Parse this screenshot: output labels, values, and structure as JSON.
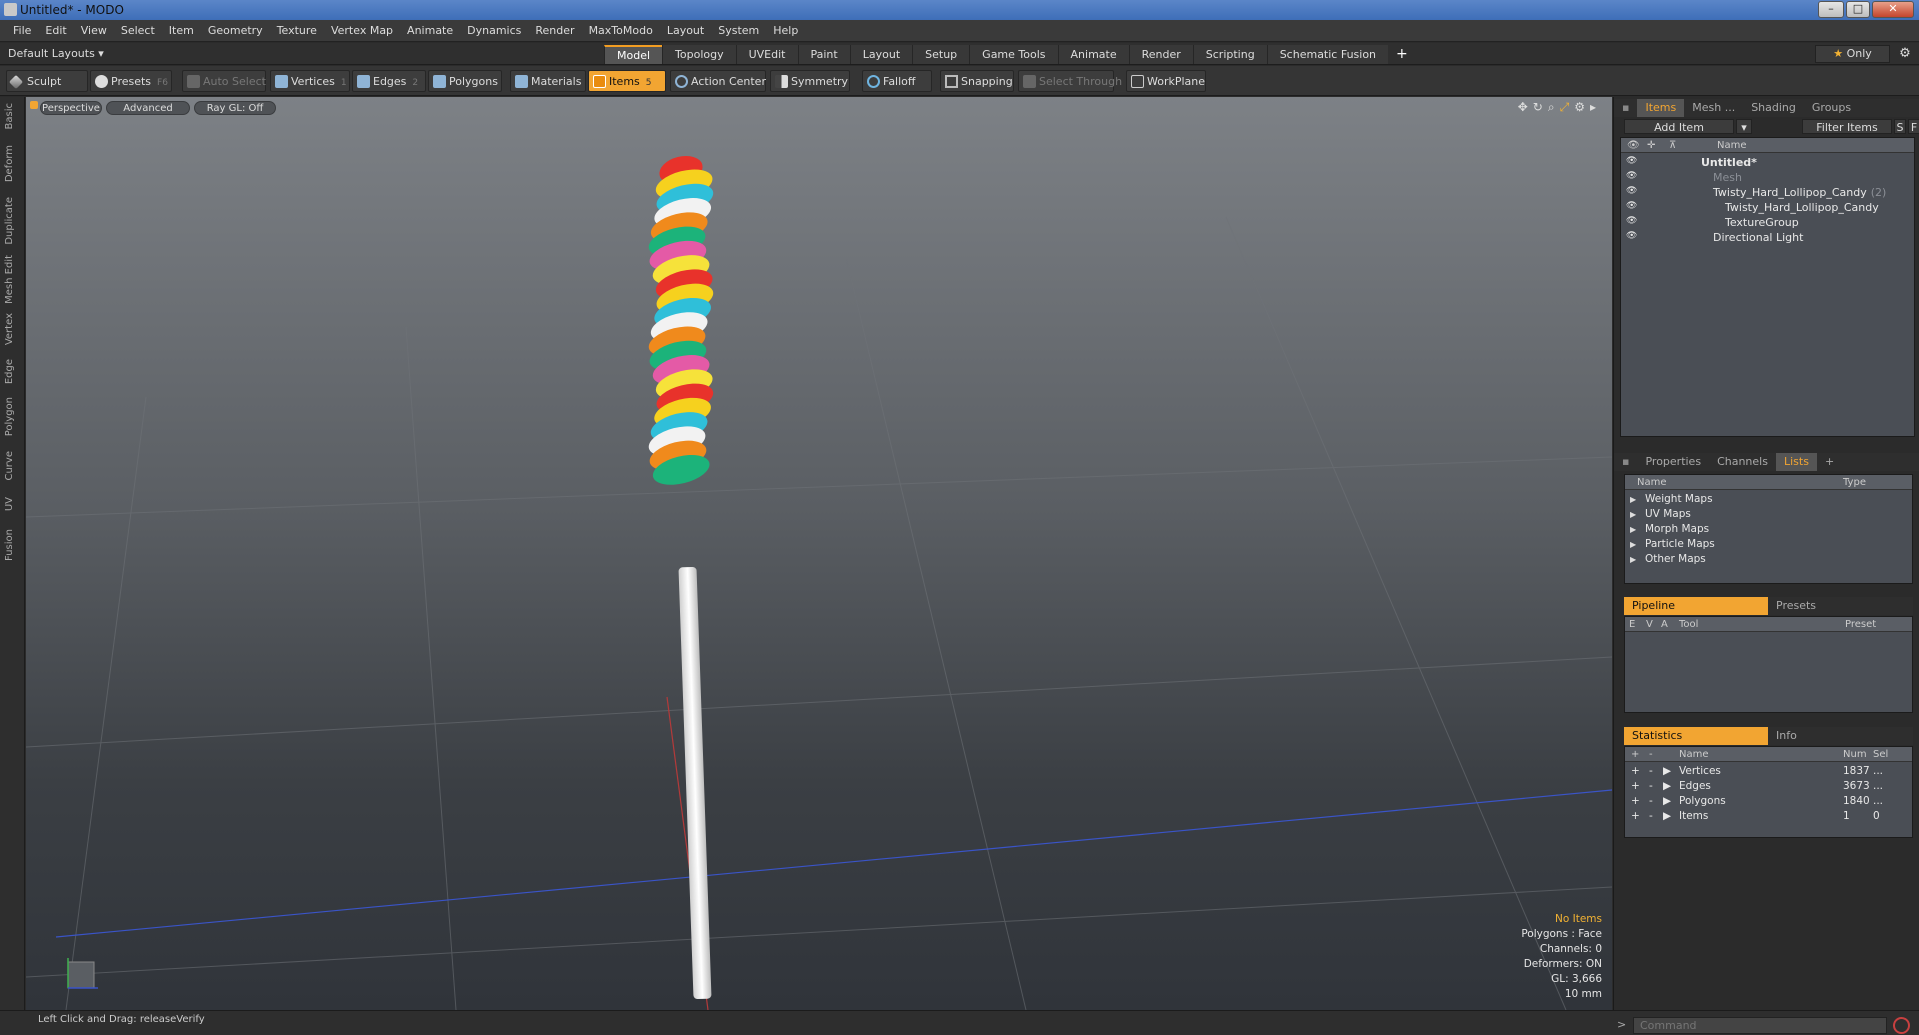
{
  "window": {
    "title": "Untitled* - MODO",
    "minimize": "–",
    "maximize": "□",
    "close": "✕"
  },
  "menubar": [
    "File",
    "Edit",
    "View",
    "Select",
    "Item",
    "Geometry",
    "Texture",
    "Vertex Map",
    "Animate",
    "Dynamics",
    "Render",
    "MaxToModo",
    "Layout",
    "System",
    "Help"
  ],
  "layoutbar": {
    "layout_select": "Default Layouts ▾",
    "tabs": [
      "Model",
      "Topology",
      "UVEdit",
      "Paint",
      "Layout",
      "Setup",
      "Game Tools",
      "Animate",
      "Render",
      "Scripting",
      "Schematic Fusion"
    ],
    "active_tab": "Model",
    "add": "+",
    "only": "Only",
    "star": "★",
    "gear": "⚙"
  },
  "toolbar": {
    "sculpt": "Sculpt",
    "presets": "Presets",
    "presets_key": "F6",
    "auto_select": "Auto Select",
    "vertices": "Vertices",
    "vertices_key": "1",
    "edges": "Edges",
    "edges_key": "2",
    "polygons": "Polygons",
    "materials": "Materials",
    "items": "Items",
    "items_key": "5",
    "action_center": "Action Center",
    "symmetry": "Symmetry",
    "falloff": "Falloff",
    "snapping": "Snapping",
    "select_through": "Select Through",
    "workplane": "WorkPlane"
  },
  "left_tabs": [
    "Basic",
    "Deform",
    "Duplicate",
    "Mesh Edit",
    "Vertex",
    "Edge",
    "Polygon",
    "Curve",
    "UV",
    "Fusion"
  ],
  "viewport": {
    "perspective": "Perspective",
    "advanced": "Advanced",
    "raygl": "Ray GL: Off",
    "stats": {
      "no_items": "No Items",
      "polygons": "Polygons : Face",
      "channels": "Channels: 0",
      "deformers": "Deformers: ON",
      "gl": "GL: 3,666",
      "scale": "10 mm"
    }
  },
  "items_panel": {
    "tabs": [
      "Items",
      "Mesh ...",
      "Shading",
      "Groups"
    ],
    "active_tab": "Items",
    "add_item": "Add Item",
    "filter_items": "Filter Items",
    "s_btn": "S",
    "f_btn": "F",
    "name_header": "Name",
    "tree": [
      {
        "label": "Untitled*",
        "indent": 0,
        "bold": true,
        "dim": false
      },
      {
        "label": "Mesh",
        "indent": 1,
        "bold": false,
        "dim": true
      },
      {
        "label": "Twisty_Hard_Lollipop_Candy",
        "suffix": "(2)",
        "indent": 1,
        "bold": false,
        "dim": false
      },
      {
        "label": "Twisty_Hard_Lollipop_Candy",
        "indent": 2,
        "bold": false,
        "dim": false
      },
      {
        "label": "TextureGroup",
        "indent": 2,
        "bold": false,
        "dim": false
      },
      {
        "label": "Directional Light",
        "indent": 1,
        "bold": false,
        "dim": false
      }
    ]
  },
  "lists_panel": {
    "tabs": [
      "Properties",
      "Channels",
      "Lists"
    ],
    "active_tab": "Lists",
    "add": "+",
    "name_header": "Name",
    "type_header": "Type",
    "rows": [
      "Weight Maps",
      "UV Maps",
      "Morph Maps",
      "Particle Maps",
      "Other Maps"
    ]
  },
  "pipeline_panel": {
    "tabs": [
      "Pipeline",
      "Presets"
    ],
    "headers": {
      "e": "E",
      "v": "V",
      "a": "A",
      "tool": "Tool",
      "preset": "Preset"
    }
  },
  "stats_panel": {
    "tabs": [
      "Statistics",
      "Info"
    ],
    "headers": {
      "plus": "+",
      "minus": "-",
      "name": "Name",
      "num": "Num",
      "sel": "Sel"
    },
    "rows": [
      {
        "name": "Vertices",
        "num": "1837",
        "sel": "..."
      },
      {
        "name": "Edges",
        "num": "3673",
        "sel": "..."
      },
      {
        "name": "Polygons",
        "num": "1840",
        "sel": "..."
      },
      {
        "name": "Items",
        "num": "1",
        "sel": "0"
      }
    ]
  },
  "statusbar": {
    "hint": "Left Click and Drag:   releaseVerify",
    "command_placeholder": "Command",
    "prompt": ">"
  }
}
